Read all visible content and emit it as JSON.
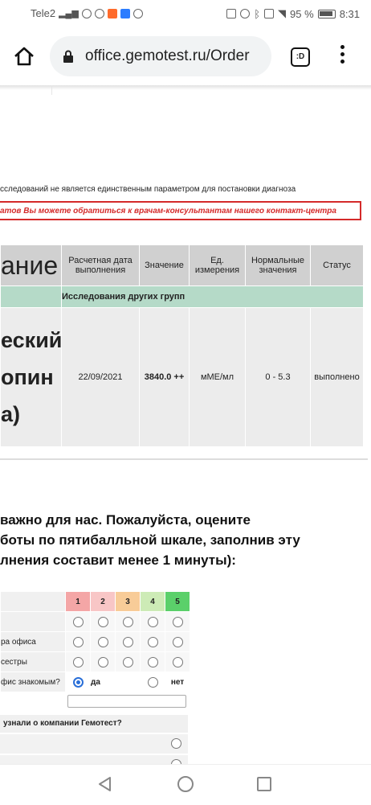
{
  "status_bar": {
    "carrier": "Tele2",
    "battery": "95 %",
    "time": "8:31",
    "icons": [
      "signal-icon",
      "eye-icon",
      "app-icon",
      "app-orange-icon",
      "app-blue-icon",
      "viber-icon",
      "nfc-icon",
      "alarm-icon",
      "bluetooth-icon",
      "vibrate-icon",
      "wifi-icon",
      "battery-icon"
    ]
  },
  "browser": {
    "url": "office.gemotest.ru/Order",
    "tabs_label": ":D"
  },
  "page": {
    "note": "сследований не является единственным параметром для постановки диагноза",
    "alert": "атов Вы можете обратиться к врачам-консультантам нашего контакт-центра",
    "table": {
      "headers": [
        "ание",
        "Расчетная дата выполнения",
        "Значение",
        "Ед. измерения",
        "Нормальные значения",
        "Статус"
      ],
      "group": "Исследования других групп",
      "row": {
        "name_lines": [
          "еский",
          "опин",
          "а)"
        ],
        "date": "22/09/2021",
        "value": "3840.0 ++",
        "unit": "мМЕ/мл",
        "norm": "0 - 5.3",
        "status": "выполнено"
      }
    },
    "survey": {
      "title_lines": [
        " важно для нас. Пожалуйста, оцените",
        "боты по пятибалльной шкале, заполнив эту",
        "лнения составит менее 1 минуты):"
      ],
      "scale": [
        "1",
        "2",
        "3",
        "4",
        "5"
      ],
      "rows": [
        "",
        "ра офиса",
        "сестры"
      ],
      "familiar_question": "фис знакомым?",
      "yes": "да",
      "no": "нет",
      "source_question": "узнали о компании Гемотест?"
    }
  }
}
